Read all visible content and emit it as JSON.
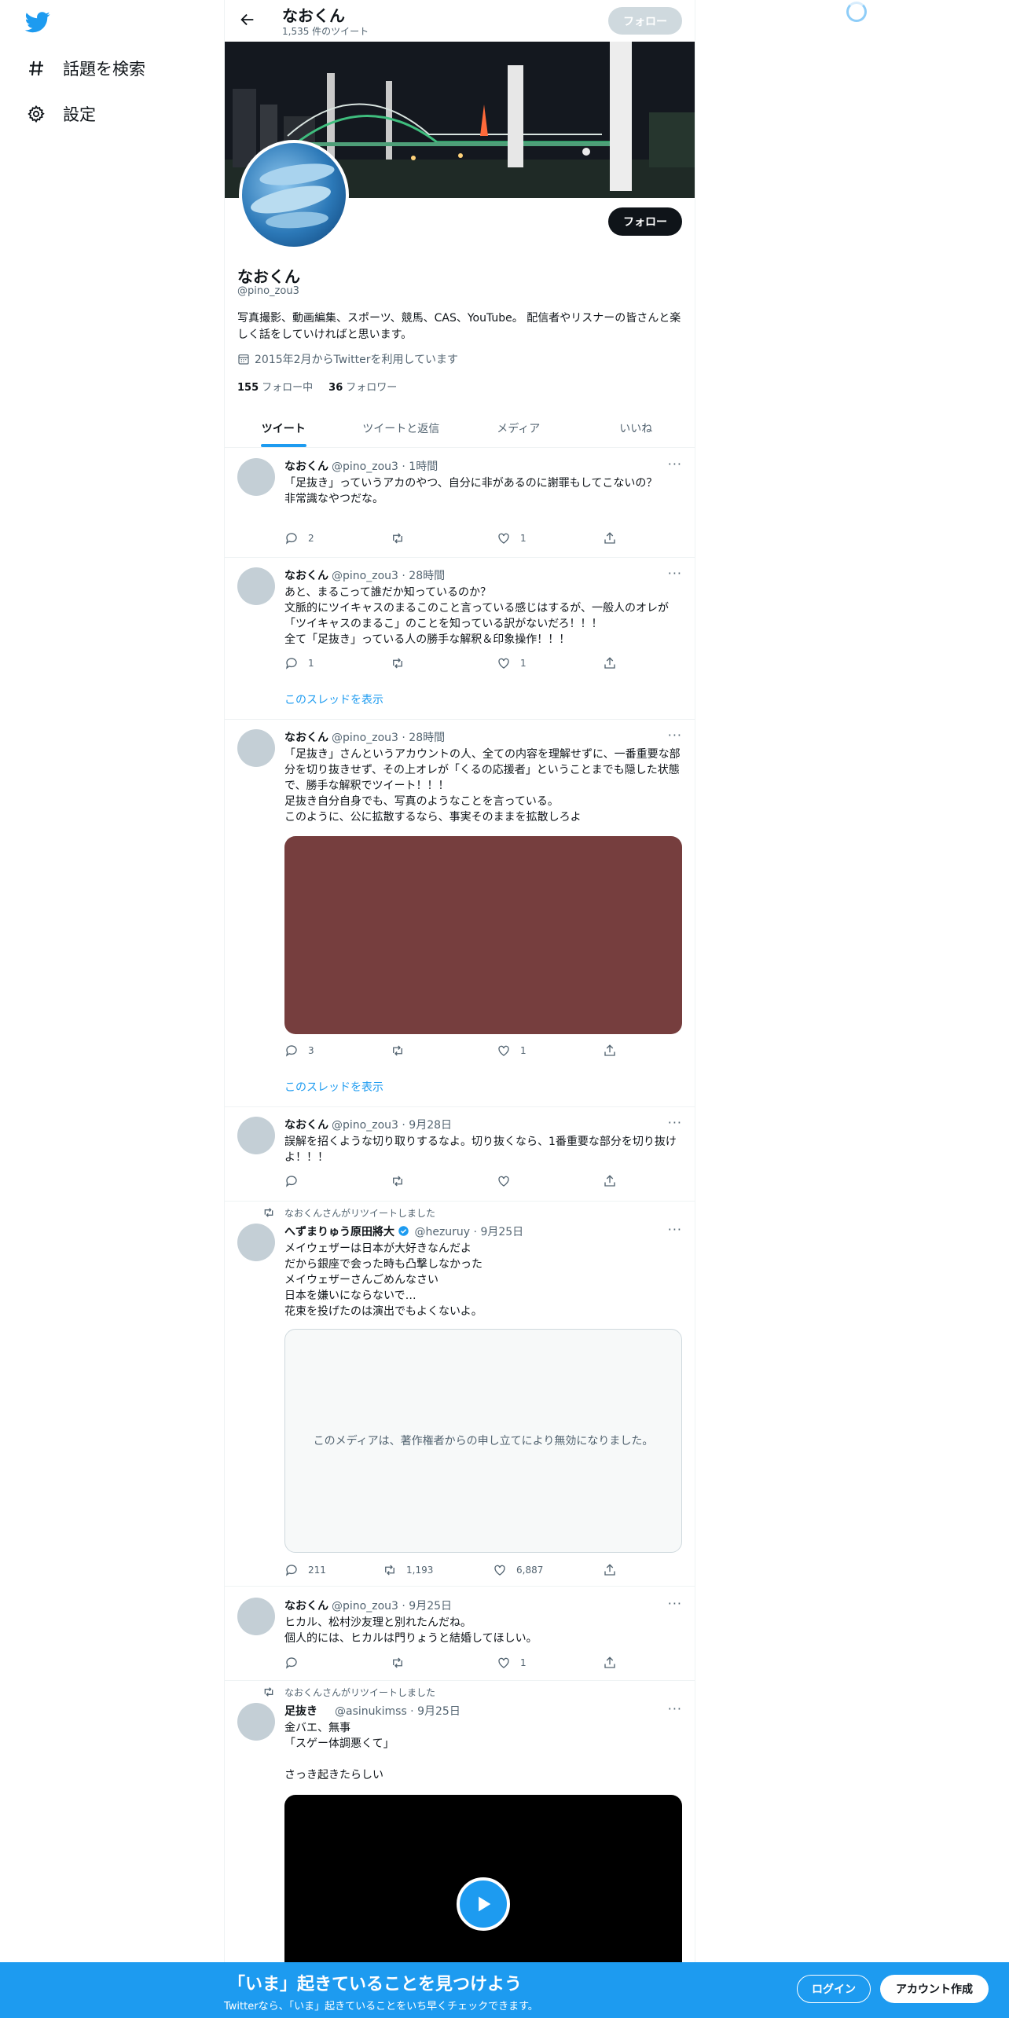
{
  "nav": {
    "explore_label": "話題を検索",
    "settings_label": "設定"
  },
  "header": {
    "name": "なおくん",
    "tweet_count": "1,535 件のツイート",
    "follow_label": "フォロー"
  },
  "profile": {
    "name": "なおくん",
    "handle": "@pino_zou3",
    "bio": "写真撮影、動画編集、スポーツ、競馬、CAS、YouTube。 配信者やリスナーの皆さんと楽しく話をしていければと思います。",
    "joined": "2015年2月からTwitterを利用しています",
    "following_count": "155",
    "following_label": "フォロー中",
    "followers_count": "36",
    "followers_label": "フォロワー",
    "follow_label": "フォロー"
  },
  "tabs": [
    {
      "label": "ツイート"
    },
    {
      "label": "ツイートと返信"
    },
    {
      "label": "メディア"
    },
    {
      "label": "いいね"
    }
  ],
  "tweets": [
    {
      "name": "なおくん",
      "handle": "@pino_zou3",
      "time": "1時間",
      "text": "「足抜き」っていうアカのやつ、自分に非があるのに謝罪もしてこないの？\n非常識なやつだな。",
      "replies": "2",
      "retweets": "",
      "likes": "1"
    },
    {
      "name": "なおくん",
      "handle": "@pino_zou3",
      "time": "28時間",
      "text": "あと、まるこって誰だか知っているのか？\n文脈的にツイキャスのまるこのこと言っている感じはするが、一般人のオレが「ツイキャスのまるこ」のことを知っている訳がないだろ！！！\n全て「足抜き」っている人の勝手な解釈＆印象操作！！！",
      "replies": "1",
      "retweets": "",
      "likes": "1",
      "thread_label": "このスレッドを表示"
    },
    {
      "name": "なおくん",
      "handle": "@pino_zou3",
      "time": "28時間",
      "text": "「足抜き」さんというアカウントの人、全ての内容を理解せずに、一番重要な部分を切り抜きせず、その上オレが「くるの応援者」ということまでも隠した状態で、勝手な解釈でツイート！！！\n足抜き自分自身でも、写真のようなことを言っている。\nこのように、公に拡散するなら、事実そのままを拡散しろよ",
      "replies": "3",
      "retweets": "",
      "likes": "1",
      "media_color": "#763e3e",
      "thread_label": "このスレッドを表示"
    },
    {
      "name": "なおくん",
      "handle": "@pino_zou3",
      "time": "9月28日",
      "text": "誤解を招くような切り取りするなよ。切り抜くなら、1番重要な部分を切り抜けよ！！！",
      "replies": "",
      "retweets": "",
      "likes": ""
    },
    {
      "retweeted_by": "なおくんさんがリツイートしました",
      "name": "へずまりゅう原田將大",
      "handle": "@hezuruy",
      "time": "9月25日",
      "text": "メイウェザーは日本が大好きなんだよ\nだから銀座で会った時も凸撃しなかった\nメイウェザーさんごめんなさい\n日本を嫌いにならないで…\n花束を投げたのは演出でもよくないよ。",
      "media_notice": "このメディアは、著作権者からの申し立てにより無効になりました。",
      "replies": "211",
      "retweets": "1,193",
      "likes": "6,887"
    },
    {
      "name": "なおくん",
      "handle": "@pino_zou3",
      "time": "9月25日",
      "text": "ヒカル、松村沙友理と別れたんだね。\n個人的には、ヒカルは門りょうと結婚してほしい。",
      "replies": "",
      "retweets": "",
      "likes": "1"
    },
    {
      "retweeted_by": "なおくんさんがリツイートしました",
      "name": "足抜き",
      "handle": "@asinukimss",
      "time": "9月25日",
      "text": "金バエ、無事\n「スゲー体調悪くて」\n\nさっき起きたらしい"
    }
  ],
  "bottom_bar": {
    "title": "「いま」起きていることを見つけよう",
    "subtitle": "Twitterなら、「いま」起きていることをいち早くチェックできます。",
    "login_label": "ログイン",
    "signup_label": "アカウント作成"
  },
  "colors": {
    "accent": "#1d9bf0",
    "text": "#0f1419",
    "secondary": "#536471"
  }
}
